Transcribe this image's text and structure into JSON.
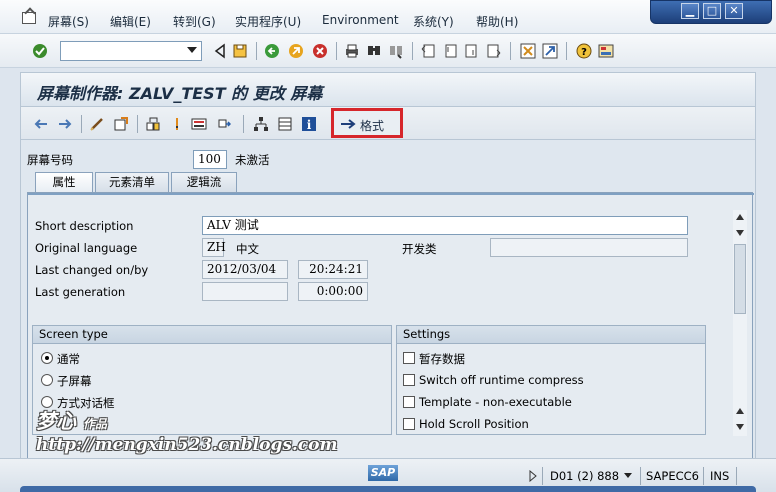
{
  "menu": {
    "items": [
      "屏幕(S)",
      "编辑(E)",
      "转到(G)",
      "实用程序(U)",
      "Environment",
      "系统(Y)",
      "帮助(H)"
    ]
  },
  "window_controls": [
    "minimize",
    "maximize",
    "close"
  ],
  "toolbar": {
    "command_field": {
      "value": "",
      "placeholder": ""
    },
    "icons": [
      "enter-icon",
      "save-icon",
      "back-icon",
      "exit-icon",
      "cancel-icon",
      "print-icon",
      "find-icon",
      "find-next-icon",
      "first-page-icon",
      "previous-page-icon",
      "next-page-icon",
      "last-page-icon",
      "create-session-icon",
      "shortcut-icon",
      "help-icon",
      "customize-layout-icon"
    ]
  },
  "title": "屏幕制作器: ZALV_TEST 的 更改 屏幕",
  "app_toolbar": {
    "icons": [
      "back-arrow-icon",
      "forward-arrow-icon",
      "edit-toggle-icon",
      "activate-icon",
      "where-used-icon",
      "info-flag-icon",
      "display-object-icon",
      "navigate-icon",
      "hierarchy-icon",
      "layout-icon",
      "information-icon"
    ],
    "format_button": "格式"
  },
  "header": {
    "screen_number_label": "屏幕号码",
    "screen_number": "100",
    "status": "未激活"
  },
  "tabs": [
    {
      "label": "属性",
      "active": true
    },
    {
      "label": "元素清单",
      "active": false
    },
    {
      "label": "逻辑流",
      "active": false
    }
  ],
  "attributes": {
    "short_description_label": "Short description",
    "short_description": "ALV 测试",
    "original_language_label": "Original language",
    "original_language_code": "ZH",
    "original_language_name": "中文",
    "dev_class_label": "开发类",
    "dev_class": "",
    "last_changed_label": "Last changed on/by",
    "last_changed_date": "2012/03/04",
    "last_changed_time": "20:24:21",
    "last_generation_label": "Last generation",
    "last_generation_date": "",
    "last_generation_time": "0:00:00"
  },
  "screen_type": {
    "title": "Screen type",
    "options": [
      {
        "label": "通常",
        "selected": true
      },
      {
        "label": "子屏幕",
        "selected": false
      },
      {
        "label": "方式对话框",
        "selected": false
      }
    ]
  },
  "settings": {
    "title": "Settings",
    "options": [
      {
        "label": "暂存数据",
        "checked": false
      },
      {
        "label": "Switch off runtime compress",
        "checked": false
      },
      {
        "label": "Template - non-executable",
        "checked": false
      },
      {
        "label": "Hold Scroll Position",
        "checked": false
      }
    ]
  },
  "status_bar": {
    "logo": "SAP",
    "session": "D01 (2) 888",
    "server": "SAPECC6",
    "mode": "INS"
  },
  "watermark": {
    "line1": "梦心",
    "line1_small": "作品",
    "line2": "http://mengxin523.cnblogs.com"
  },
  "colors": {
    "highlight_border": "#d6262b",
    "window_controls": "#2a5699",
    "tab_strip": "#7fa0c2"
  }
}
